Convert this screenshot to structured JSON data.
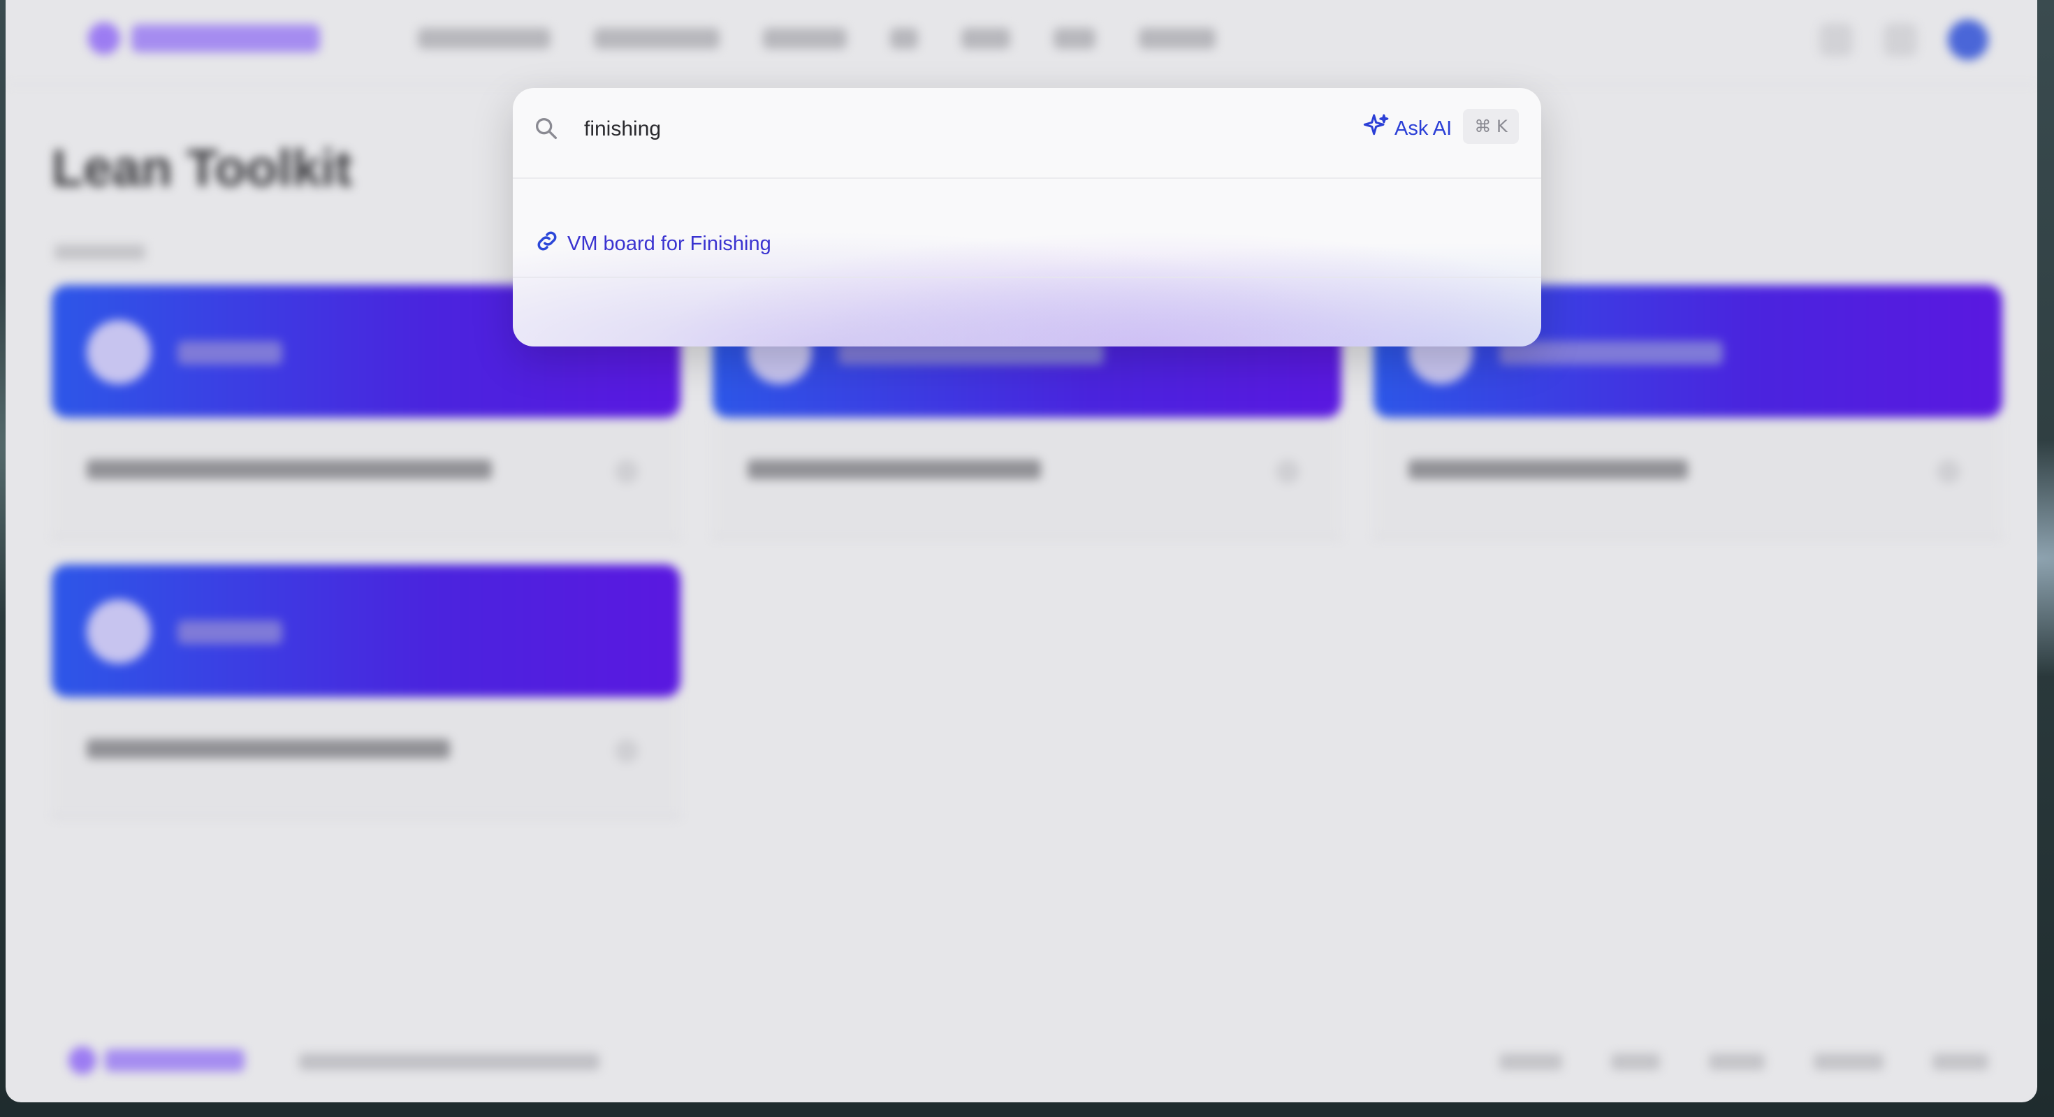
{
  "app": {
    "title": "Lean Toolkit"
  },
  "search": {
    "query": "finishing",
    "ask_ai_label": "Ask AI",
    "shortcut": "⌘ K"
  },
  "results": [
    {
      "label": "VM board for Finishing",
      "icon": "link-icon"
    }
  ],
  "colors": {
    "accent": "#2b3fd6",
    "result_text": "#3a33d0",
    "card_gradient_start": "#2d57e8",
    "card_gradient_end": "#5a18e0"
  }
}
